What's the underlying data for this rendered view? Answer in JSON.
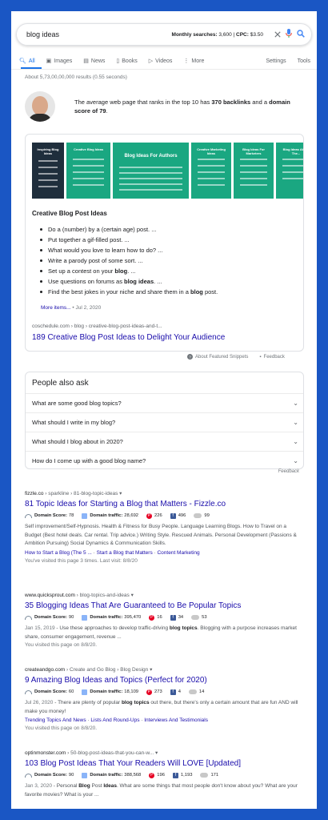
{
  "search": {
    "query": "blog ideas",
    "monthly_label": "Monthly searches:",
    "monthly_value": "3,600",
    "cpc_label": "CPC:",
    "cpc_value": "$3.50"
  },
  "tabs": {
    "all": "All",
    "images": "Images",
    "news": "News",
    "books": "Books",
    "videos": "Videos",
    "more": "More",
    "settings": "Settings",
    "tools": "Tools"
  },
  "results_count": "About 5,73,00,00,000 results (0.55 seconds)",
  "banner": {
    "text_1": "The average web page that ranks in the top 10 has ",
    "backlinks": "370 backlinks",
    "text_2": " and a ",
    "domain_score": "domain score of 79",
    "text_3": "."
  },
  "featured": {
    "thumbs": [
      {
        "title": "Inspiring Blog Ideas"
      },
      {
        "title": "Creative Blog Ideas"
      },
      {
        "title": "Blog Ideas For Authors"
      },
      {
        "title": "Creative Marketing Ideas"
      },
      {
        "title": "Blog Ideas For Marketers"
      },
      {
        "title": "Blog Ideas About The..."
      }
    ],
    "title": "Creative Blog Post Ideas",
    "items": [
      {
        "pre": "Do a (number) by a (certain age) post. ...",
        "bold": "",
        "post": ""
      },
      {
        "pre": "Put together a gif-filled post. ...",
        "bold": "",
        "post": ""
      },
      {
        "pre": "What would you love to learn how to do? ...",
        "bold": "",
        "post": ""
      },
      {
        "pre": "Write a parody post of some sort. ...",
        "bold": "",
        "post": ""
      },
      {
        "pre": "Set up a contest on your ",
        "bold": "blog",
        "post": ". ..."
      },
      {
        "pre": "Use questions on forums as ",
        "bold": "blog ideas",
        "post": ". ..."
      },
      {
        "pre": "Find the best jokes in your niche and share them in a ",
        "bold": "blog",
        "post": " post."
      }
    ],
    "more_items": "More items...",
    "date": " • Jul 2, 2020",
    "url": "coschedule.com › blog › creative-blog-post-ideas-and-t...",
    "link": "189 Creative Blog Post Ideas to Delight Your Audience",
    "about": "About Featured Snippets",
    "feedback": "Feedback"
  },
  "paa": {
    "title": "People also ask",
    "questions": [
      "What are some good blog topics?",
      "What should I write in my blog?",
      "What should I blog about in 2020?",
      "How do I come up with a good blog name?"
    ],
    "feedback": "Feedback"
  },
  "metric_labels": {
    "domain_score": "Domain Score:",
    "domain_traffic": "Domain traffic:"
  },
  "results": [
    {
      "domain": "fizzle.co",
      "crumb": " › sparkline › 81-blog-topic-ideas",
      "title": "81 Topic Ideas for Starting a Blog that Matters - Fizzle.co",
      "score": "78",
      "traffic": "28,692",
      "pins": "226",
      "fb": "496",
      "other": "99",
      "desc": "Self improvement/Self-Hypnosis. Health & Fitness for Busy People. Language Learning Blogs. How to Travel on a Budget (Best hotel deals. Car rental. Trip advice.) Writing Style. Rescued Animals. Personal Development (Passions & Ambition Pursuing) Social Dynamics & Communication Skills.",
      "links": [
        "How to Start a Blog (The 5 ...",
        "Start a Blog that Matters",
        "Content Marketing"
      ],
      "visited": "You've visited this page 3 times. Last visit: 8/8/20"
    },
    {
      "domain": "www.quicksprout.com",
      "crumb": " › blog-topics-and-ideas",
      "title": "35 Blogging Ideas That Are Guaranteed to Be Popular Topics",
      "score": "90",
      "traffic": "395,470",
      "pins": "16",
      "fb": "34",
      "other": "53",
      "date": "Jan 15, 2019",
      "desc_1": " - Use these approaches to develop traffic-driving ",
      "desc_bold": "blog topics",
      "desc_2": ". Blogging with a purpose increases market share, consumer engagement, revenue ...",
      "visited": "You visited this page on 8/8/20."
    },
    {
      "domain": "createandgo.com",
      "crumb": " › Create and Go Blog › Blog Design",
      "title": "9 Amazing Blog Ideas and Topics (Perfect for 2020)",
      "score": "60",
      "traffic": "18,109",
      "pins": "273",
      "fb": "4",
      "other": "14",
      "date": "Jul 26, 2020",
      "desc_1": " - There are plenty of popular ",
      "desc_bold": "blog topics",
      "desc_2": " out there, but there's only a certain amount that are fun AND will make you money!",
      "links": [
        "Trending Topics And News",
        "Lists And Round-Ups",
        "Interviews And Testimonials"
      ],
      "visited": "You visited this page on 8/8/20."
    },
    {
      "domain": "optinmonster.com",
      "crumb": " › 50-blog-post-ideas-that-you-can-w...",
      "title": "103 Blog Post Ideas That Your Readers Will LOVE [Updated]",
      "score": "90",
      "traffic": "388,568",
      "pins": "196",
      "fb": "1,193",
      "other": "171",
      "date": "Jan 3, 2020",
      "desc_1": " - Personal ",
      "desc_bold": "Blog",
      "desc_mid": " Post ",
      "desc_bold2": "Ideas",
      "desc_2": ". What are some things that most people don't know about you? What are your favorite movies? What is your ..."
    }
  ]
}
